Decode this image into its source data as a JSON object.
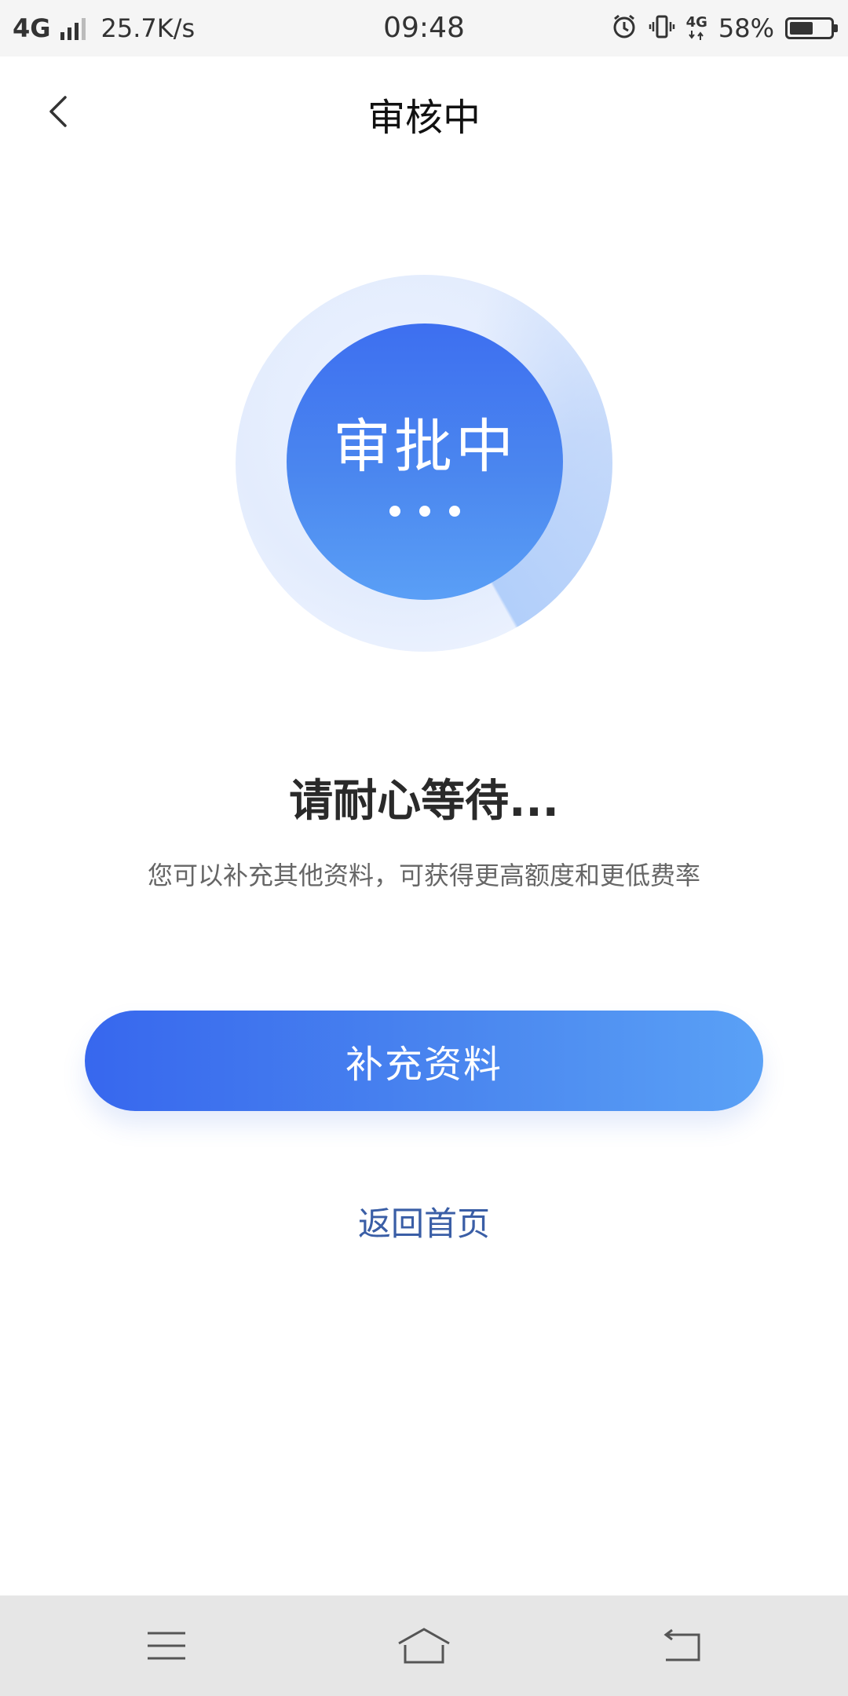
{
  "status_bar": {
    "network": "4G",
    "speed": "25.7K/s",
    "time": "09:48",
    "network_right": "4G",
    "battery_percent_text": "58%",
    "battery_level": 0.58
  },
  "nav": {
    "title": "审核中",
    "back_icon": "chevron-left-icon"
  },
  "illustration": {
    "text": "审批中",
    "primary_color": "#3d6ff0",
    "secondary_color": "#5a9ff6"
  },
  "content": {
    "headline": "请耐心等待...",
    "subtext": "您可以补充其他资料，可获得更高额度和更低费率"
  },
  "actions": {
    "primary_button": "补充资料",
    "home_link": "返回首页"
  },
  "system_nav": {
    "menu_icon": "menu-icon",
    "home_icon": "home-icon",
    "back_icon": "back-icon"
  }
}
